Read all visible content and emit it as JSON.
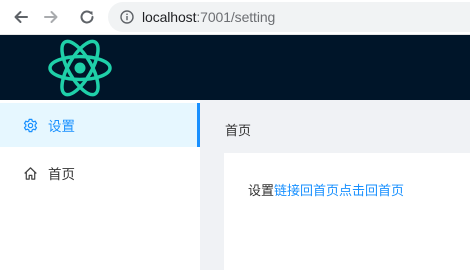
{
  "browser": {
    "url_host": "localhost",
    "url_path": ":7001/setting",
    "icons": [
      "back-arrow-icon",
      "forward-arrow-icon",
      "reload-icon",
      "info-icon"
    ]
  },
  "header": {
    "logo": "react-logo-icon",
    "logo_color": "#1fd0a9",
    "background": "#001529"
  },
  "sidebar": {
    "items": [
      {
        "label": "设置",
        "icon": "gear-icon",
        "active": true
      },
      {
        "label": "首页",
        "icon": "home-icon",
        "active": false
      }
    ],
    "accent": "#1890ff"
  },
  "main": {
    "breadcrumb": "首页",
    "content_prefix": "设置",
    "link1": "链接回首页",
    "link2": "点击回首页"
  }
}
